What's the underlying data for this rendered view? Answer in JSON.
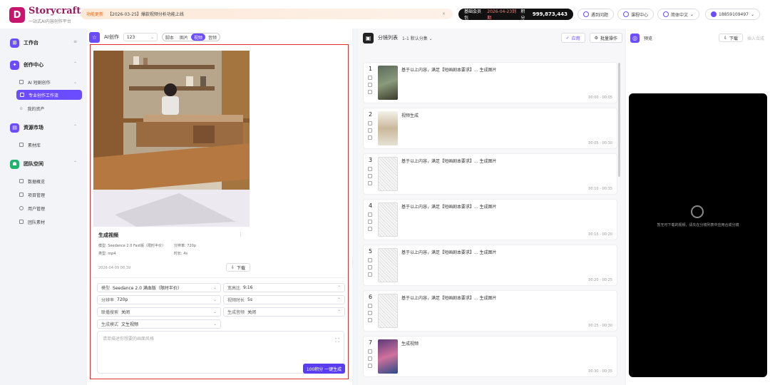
{
  "brand": {
    "name": "Storycraft",
    "tagline": "一站式AI内容创作平台",
    "logo_letter": "D"
  },
  "notice": {
    "tag": "功能更新",
    "text": "【2026-03-25】爆款视频分析功能上线",
    "close": "×"
  },
  "plan": {
    "name": "基础会员包",
    "expiry": "2026-04-23到期",
    "points_label": "积分",
    "points": "999,873,443"
  },
  "topbar": {
    "faq": "遇到问题",
    "courses": "课程中心",
    "language": "简体中文",
    "user": "18859109497"
  },
  "sidebar": {
    "sections": [
      {
        "label": "工作台",
        "color": "#6b4cff",
        "glyph": "⊞"
      },
      {
        "label": "创作中心",
        "color": "#6b4cff",
        "glyph": "✦"
      },
      {
        "label": "资源市场",
        "color": "#6b4cff",
        "glyph": "▤"
      },
      {
        "label": "团队空间",
        "color": "#1fb36e",
        "glyph": "☗"
      }
    ],
    "creation_items": [
      "AI 短剧创作",
      "专业创作工作流",
      "我的资产"
    ],
    "resource_items": [
      "素材库"
    ],
    "team_items": [
      "数据概览",
      "项目管理",
      "用户管理",
      "团队素材"
    ]
  },
  "center": {
    "title": "AI创作",
    "project": "123",
    "modes": [
      "脚本",
      "图片",
      "视频",
      "音频"
    ],
    "active_mode": "视频",
    "card": {
      "title": "生成视频",
      "model_label": "模型:",
      "model": "Seedance 2.0 Fast版（限时半价）",
      "resolution_label": "分辨率:",
      "resolution": "720p",
      "format_label": "类型:",
      "format": "mp4",
      "duration_label": "时长:",
      "duration": "4s",
      "date": "2026-04-09 06:39",
      "download": "下载"
    },
    "form": {
      "model_label": "模型",
      "model": "Seedance 2.0 满血版（限时半价）",
      "ratio_label": "宽高比",
      "ratio": "9:16",
      "resolution_label": "分辨率",
      "resolution": "720p",
      "duration_label": "视频时长",
      "duration": "5s",
      "search_label": "联播搜索",
      "search": "关闭",
      "audio_label": "生成音频",
      "audio": "关闭",
      "gen_mode_label": "生成模式",
      "gen_mode": "文生视频",
      "prompt_placeholder": "请单描述你想要的画面风格",
      "generate_button": "100积分 一键生成"
    }
  },
  "storyboard": {
    "title": "分镜列表",
    "group": "1-1 默认分集",
    "apply_button": "应用",
    "batch_button": "批量操作",
    "shots": [
      {
        "num": "1",
        "text": "基于以上内容，满足【短画剧本要求】... 生成图片",
        "time": "00:00 - 00:05"
      },
      {
        "num": "2",
        "text": "视频生成",
        "time": "00:05 - 00:10"
      },
      {
        "num": "3",
        "text": "基于以上内容，满足【短画剧本要求】... 生成图片",
        "time": "00:10 - 00:15"
      },
      {
        "num": "4",
        "text": "基于以上内容，满足【短画剧本要求】... 生成图片",
        "time": "00:15 - 00:20"
      },
      {
        "num": "5",
        "text": "基于以上内容，满足【短画剧本要求】... 生成图片",
        "time": "00:20 - 00:25"
      },
      {
        "num": "6",
        "text": "基于以上内容，满足【短画剧本要求】... 生成图片",
        "time": "00:25 - 00:30"
      },
      {
        "num": "7",
        "text": "生成视频",
        "time": "00:30 - 00:35"
      }
    ]
  },
  "preview": {
    "title": "预览",
    "download": "下载",
    "other": "插入合成",
    "empty_message": "暂无可下载的视频，请先在分镜列表中应用合成分镜"
  }
}
